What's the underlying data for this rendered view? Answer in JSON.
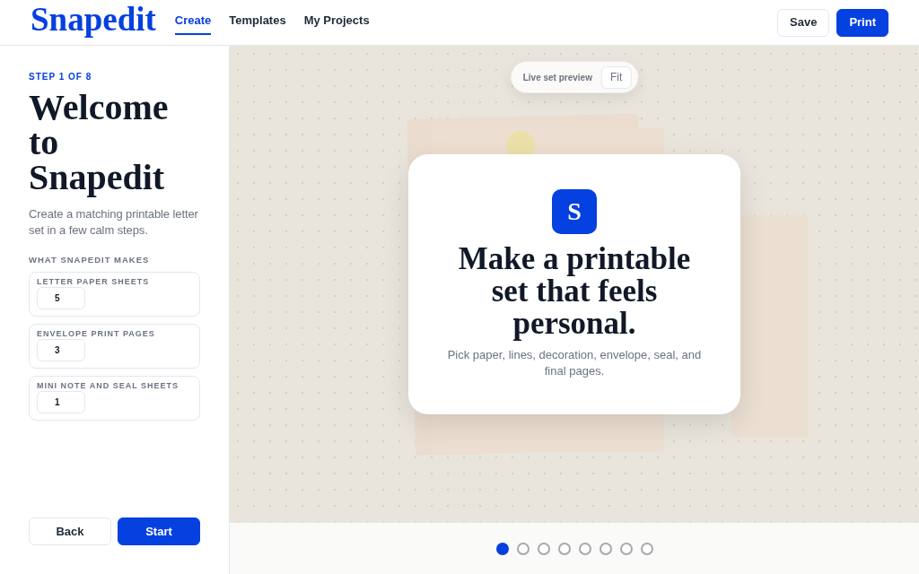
{
  "header": {
    "logo": "Snapedit",
    "nav": [
      {
        "label": "Create",
        "selected": true
      },
      {
        "label": "Templates",
        "selected": false
      },
      {
        "label": "My Projects",
        "selected": false
      }
    ],
    "actions": [
      {
        "label": "Save",
        "kind": "secondary"
      },
      {
        "label": "Print",
        "kind": "primary"
      }
    ]
  },
  "sidebar": {
    "step": "STEP 1 OF 8",
    "title": "Welcome to Snapedit",
    "description": "Create a matching printable letter set in a few calm steps.",
    "section_label": "WHAT SNAPEDIT MAKES",
    "outputs": [
      {
        "label": "LETTER PAPER SHEETS",
        "value": "5"
      },
      {
        "label": "ENVELOPE PRINT PAGES",
        "value": "3"
      },
      {
        "label": "MINI NOTE AND SEAL SHEETS",
        "value": "1"
      }
    ],
    "buttons": [
      {
        "label": "Back",
        "kind": "secondary"
      },
      {
        "label": "Start",
        "kind": "primary"
      }
    ]
  },
  "preview": {
    "label": "Live set preview",
    "fit_button": "Fit",
    "card": {
      "icon_letter": "S",
      "title": "Make a printable set that feels personal.",
      "subtitle": "Pick paper, lines, decoration, envelope, seal, and final pages."
    }
  },
  "pager": [
    {
      "selected": true
    },
    {
      "selected": false
    },
    {
      "selected": false
    },
    {
      "selected": false
    },
    {
      "selected": false
    },
    {
      "selected": false
    },
    {
      "selected": false
    },
    {
      "selected": false
    }
  ]
}
